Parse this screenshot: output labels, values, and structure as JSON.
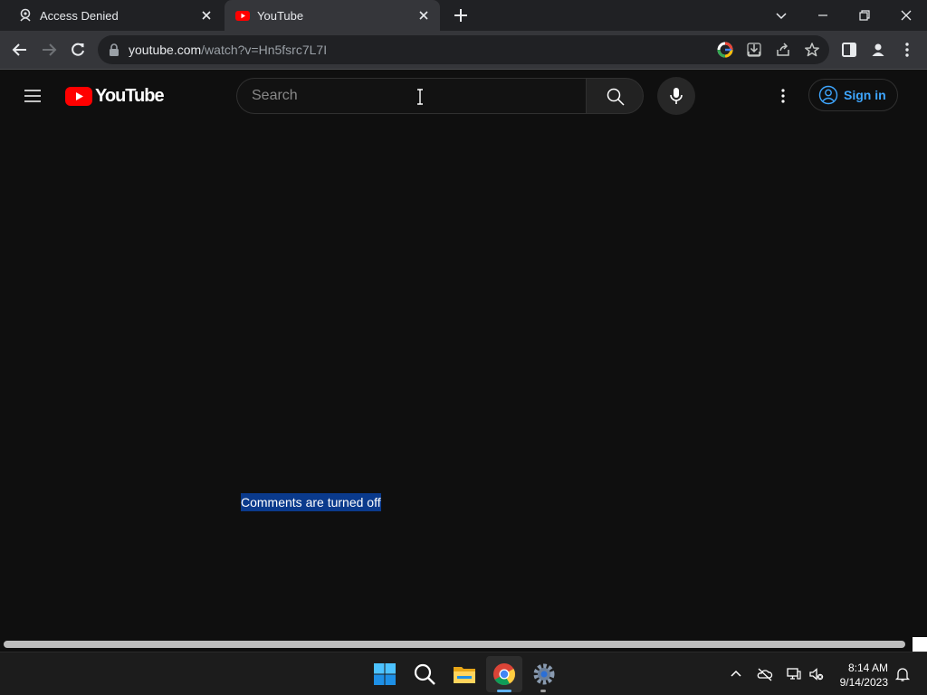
{
  "browser": {
    "tabs": [
      {
        "title": "Access Denied",
        "icon": "security-shield-icon",
        "active": false
      },
      {
        "title": "YouTube",
        "icon": "youtube-favicon-icon",
        "active": true
      }
    ],
    "address": {
      "host": "youtube.com",
      "path": "/watch?v=Hn5fsrc7L7I"
    },
    "colors": {
      "tabstrip": "#202124",
      "toolbar": "#35363a",
      "omnibox": "#202124"
    }
  },
  "youtube": {
    "logo_text": "YouTube",
    "search_placeholder": "Search",
    "signin_label": "Sign in",
    "colors": {
      "background": "#0f0f0f",
      "brand_red": "#ff0000",
      "link_blue": "#3ea6ff"
    }
  },
  "page": {
    "comments_status": "Comments are turned off",
    "selection_color": "#0a3a8c"
  },
  "taskbar": {
    "apps": [
      "windows-start-icon",
      "search-icon",
      "file-explorer-icon",
      "chrome-icon",
      "settings-icon"
    ],
    "clock": {
      "time": "8:14 AM",
      "date": "9/14/2023"
    }
  }
}
